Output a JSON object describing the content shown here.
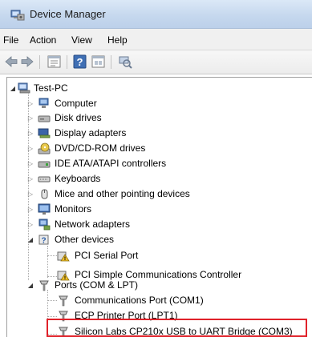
{
  "window": {
    "title": "Device Manager"
  },
  "menu": {
    "items": [
      "File",
      "Action",
      "View",
      "Help"
    ]
  },
  "toolbar": {
    "buttons": [
      "back-icon",
      "forward-icon",
      "properties-icon",
      "help-icon",
      "view-icon",
      "scan-icon"
    ]
  },
  "tree": {
    "root": "Test-PC",
    "items": [
      {
        "label": "Computer",
        "icon": "computer-icon",
        "expanded": false
      },
      {
        "label": "Disk drives",
        "icon": "disk-drive-icon",
        "expanded": false
      },
      {
        "label": "Display adapters",
        "icon": "display-adapter-icon",
        "expanded": false
      },
      {
        "label": "DVD/CD-ROM drives",
        "icon": "dvd-drive-icon",
        "expanded": false
      },
      {
        "label": "IDE ATA/ATAPI controllers",
        "icon": "ide-controller-icon",
        "expanded": false
      },
      {
        "label": "Keyboards",
        "icon": "keyboard-icon",
        "expanded": false
      },
      {
        "label": "Mice and other pointing devices",
        "icon": "mouse-icon",
        "expanded": false
      },
      {
        "label": "Monitors",
        "icon": "monitor-icon",
        "expanded": false
      },
      {
        "label": "Network adapters",
        "icon": "network-adapter-icon",
        "expanded": false
      },
      {
        "label": "Other devices",
        "icon": "other-devices-icon",
        "expanded": true,
        "children": [
          {
            "label": "PCI Serial Port",
            "icon": "warning-device-icon"
          },
          {
            "label": "PCI Simple Communications Controller",
            "icon": "warning-device-icon"
          }
        ]
      },
      {
        "label": "Ports (COM & LPT)",
        "icon": "port-icon",
        "expanded": true,
        "children": [
          {
            "label": "Communications Port (COM1)",
            "icon": "port-icon"
          },
          {
            "label": "ECP Printer Port (LPT1)",
            "icon": "port-icon"
          },
          {
            "label": "Silicon Labs CP210x USB to UART Bridge (COM3)",
            "icon": "port-icon",
            "highlighted": true
          }
        ]
      }
    ]
  },
  "colors": {
    "highlight_border": "#e0222a",
    "titlebar": "#c6d8ee",
    "warning": "#f2c12e"
  }
}
